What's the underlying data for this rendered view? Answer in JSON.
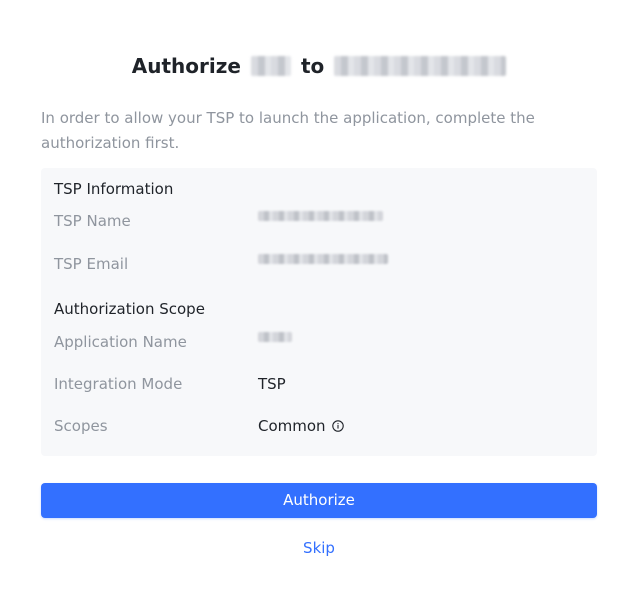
{
  "header": {
    "prefix": "Authorize",
    "connector": "to"
  },
  "intro": "In order to allow your TSP to launch the application, complete the authorization first.",
  "tsp_info": {
    "title": "TSP Information",
    "name_label": "TSP Name",
    "email_label": "TSP Email"
  },
  "scope": {
    "title": "Authorization Scope",
    "app_name_label": "Application Name",
    "mode_label": "Integration Mode",
    "mode_value": "TSP",
    "scopes_label": "Scopes",
    "scopes_value": "Common"
  },
  "actions": {
    "authorize_label": "Authorize",
    "skip_label": "Skip"
  },
  "colors": {
    "accent": "#3370ff",
    "muted_text": "#8f959e",
    "panel_bg": "#f7f8fa"
  },
  "icons": {
    "scopes_info": "info-circle-icon"
  }
}
